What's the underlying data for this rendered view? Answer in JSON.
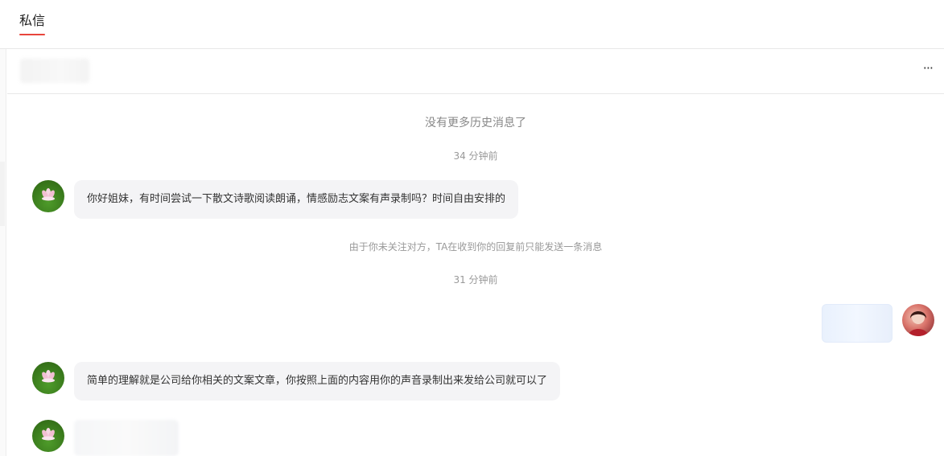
{
  "header": {
    "tab_label": "私信"
  },
  "chat": {
    "more_label": "···",
    "no_more_history": "没有更多历史消息了",
    "timestamps": [
      "34 分钟前",
      "31 分钟前"
    ],
    "notice": "由于你未关注对方，TA在收到你的回复前只能发送一条消息",
    "messages": [
      {
        "from": "other",
        "text": "你好姐妹，有时间尝试一下散文诗歌阅读朗诵，情感励志文案有声录制吗？时间自由安排的"
      },
      {
        "from": "self",
        "text": ""
      },
      {
        "from": "other",
        "text": "简单的理解就是公司给你相关的文案文章，你按照上面的内容用你的声音录制出来发给公司就可以了"
      },
      {
        "from": "other",
        "text": ""
      }
    ]
  },
  "colors": {
    "accent": "#e8453c",
    "bubble_other": "#f4f4f6",
    "bubble_self": "#ecf3fd"
  }
}
